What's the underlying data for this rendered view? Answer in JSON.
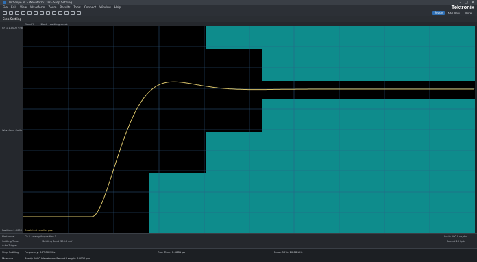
{
  "window": {
    "title": "TekScope PC - Waveform1.tss - Step Settling",
    "controls": [
      "–",
      "□",
      "✕"
    ]
  },
  "menu": {
    "items": [
      "File",
      "Edit",
      "View",
      "Waveform",
      "Zoom",
      "Results",
      "Tools",
      "Connect",
      "Window",
      "Help"
    ],
    "brand": "Tektronix"
  },
  "toolbar": {
    "icons": [
      "new-icon",
      "open-icon",
      "undo-icon",
      "redo-icon",
      "cursor-icon",
      "zoom-icon",
      "measure-icon",
      "search-icon",
      "math-icon",
      "ref-icon",
      "bus-icon",
      "marker-icon",
      "snap-icon"
    ],
    "ready_label": "Ready",
    "right_label_1": "Add New...",
    "right_label_2": "More..."
  },
  "tabs": {
    "view": "Step Settling",
    "sub": [
      "Fixed 1",
      "Mask - settling mask"
    ]
  },
  "left_panel": {
    "top_label": "Ch 1  1.0000 V/div",
    "mid_label": "Waveform  Calibration",
    "bottom_label": "Position  -1.0000 V"
  },
  "plot": {
    "trace_color": "#d9c36a",
    "mask_color": "#0e8c8c",
    "grid_color": "#2f5d86",
    "note_text": "Mask test results: pass"
  },
  "status": {
    "row1_left": "Horizontal",
    "row1_mid": "Ch 1  Analog  Acquisition 1",
    "row1_right": "Scale  500.0 ns/div",
    "row2_left": "Settling Time",
    "row2_mid": "Settling Band",
    "row2_mid2": "300.0 mV",
    "row2_right": "Record  10 kpts",
    "row3_left": "Auto Trigger"
  },
  "bottom": {
    "row1_a": "Step Settling",
    "row1_b": "Frequency:  3.7500 MHz",
    "row1_c": "Rise Time:  2.5881 μs",
    "row1_d": "Mean 50%:  10.88 kHz",
    "row2_a": "Measure",
    "row2_b": "Ready  1000 Waveforms  Record Length: 10000 pts"
  }
}
